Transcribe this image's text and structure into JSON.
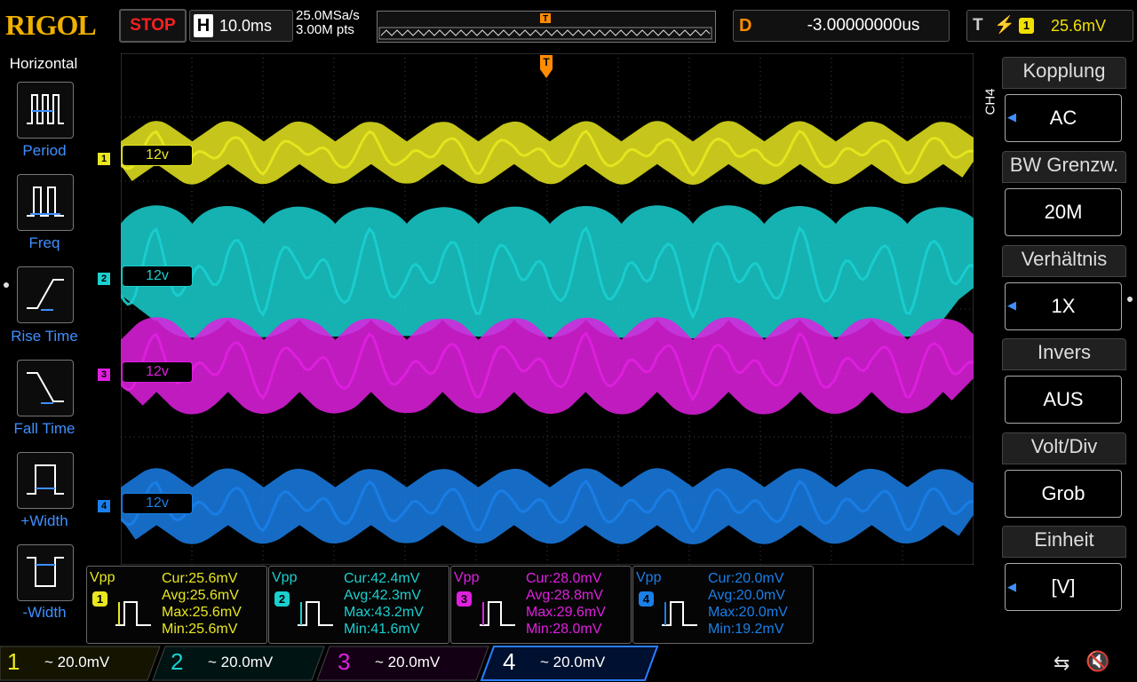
{
  "top": {
    "logo": "RIGOL",
    "run_state": "STOP",
    "horizontal_label": "H",
    "timebase": "10.0ms",
    "sample_rate": "25.0MSa/s",
    "memory_depth": "3.00M pts",
    "delay_label": "D",
    "delay": "-3.00000000us",
    "trigger_label": "T",
    "trigger_edge": "rising-edge-icon",
    "trigger_source": "1",
    "trigger_level": "25.6mV"
  },
  "left_menu": {
    "title": "Horizontal",
    "items": [
      {
        "label": "Period",
        "icon": "period-icon"
      },
      {
        "label": "Freq",
        "icon": "frequency-icon"
      },
      {
        "label": "Rise Time",
        "icon": "rise-time-icon"
      },
      {
        "label": "Fall Time",
        "icon": "fall-time-icon"
      },
      {
        "label": "+Width",
        "icon": "positive-width-icon"
      },
      {
        "label": "-Width",
        "icon": "negative-width-icon"
      }
    ]
  },
  "channels": [
    {
      "num": "1",
      "color": "#e8e820",
      "offset_label": "12v",
      "scale": "~ 20.0mV"
    },
    {
      "num": "2",
      "color": "#1ad0d0",
      "offset_label": "12v",
      "scale": "~ 20.0mV"
    },
    {
      "num": "3",
      "color": "#e020e0",
      "offset_label": "12v",
      "scale": "~ 20.0mV"
    },
    {
      "num": "4",
      "color": "#1a7fe8",
      "offset_label": "12v",
      "scale": "~ 20.0mV"
    }
  ],
  "right_menu": {
    "channel_tag": "CH4",
    "items": [
      {
        "title": "Kopplung",
        "value": "AC",
        "arrow": true
      },
      {
        "title": "BW Grenzw.",
        "value": "20M",
        "arrow": false
      },
      {
        "title": "Verhältnis",
        "value": "1X",
        "arrow": true
      },
      {
        "title": "Invers",
        "value": "AUS",
        "arrow": false
      },
      {
        "title": "Volt/Div",
        "value": "Grob",
        "arrow": false
      },
      {
        "title": "Einheit",
        "value": "[V]",
        "arrow": true
      }
    ]
  },
  "measurements": [
    {
      "type": "Vpp",
      "channel": "1",
      "cur": "Cur:25.6mV",
      "avg": "Avg:25.6mV",
      "max": "Max:25.6mV",
      "min": "Min:25.6mV"
    },
    {
      "type": "Vpp",
      "channel": "2",
      "cur": "Cur:42.4mV",
      "avg": "Avg:42.3mV",
      "max": "Max:43.2mV",
      "min": "Min:41.6mV"
    },
    {
      "type": "Vpp",
      "channel": "3",
      "cur": "Cur:28.0mV",
      "avg": "Avg:28.8mV",
      "max": "Max:29.6mV",
      "min": "Min:28.0mV"
    },
    {
      "type": "Vpp",
      "channel": "4",
      "cur": "Cur:20.0mV",
      "avg": "Avg:20.0mV",
      "max": "Max:20.0mV",
      "min": "Min:19.2mV"
    }
  ],
  "status": {
    "usb_icon": "usb-icon",
    "sound_icon": "speaker-muted-icon"
  }
}
